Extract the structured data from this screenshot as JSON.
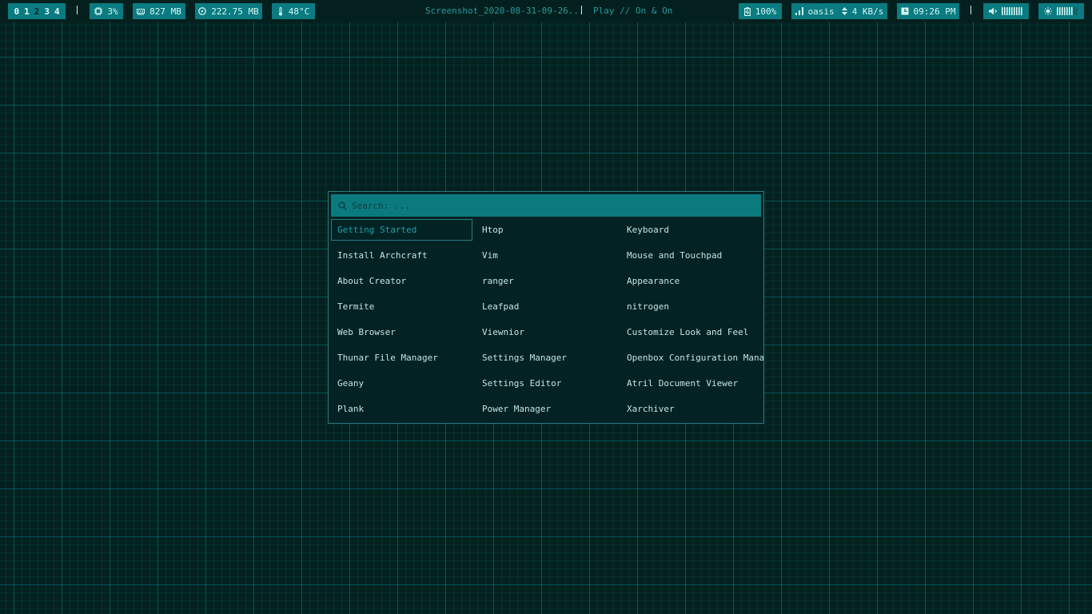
{
  "colors": {
    "background": "#03211f",
    "module_bg": "#0a7b80",
    "module_text": "#d6f6f4",
    "launcher_bg": "#032224",
    "launcher_border": "#2b7c80",
    "selected_text": "#1aa3a7"
  },
  "topbar": {
    "workspaces": [
      "0",
      "1",
      "2",
      "3",
      "4"
    ],
    "active_workspace": "2",
    "cpu": {
      "icon": "cpu-icon",
      "value": "3%"
    },
    "memory": {
      "icon": "memory-icon",
      "value": "827 MB"
    },
    "disk": {
      "icon": "disk-icon",
      "value": "222.75 MB"
    },
    "temperature": {
      "icon": "thermometer-icon",
      "value": "48°C"
    },
    "window_title": "Screenshot_2020-08-31-09-26...",
    "music": "Play // On & On",
    "battery": {
      "icon": "battery-icon",
      "value": "100%"
    },
    "network": {
      "icon": "wifi-signal-icon",
      "ssid": "oasis",
      "speed_icon": "up-down-arrows-icon",
      "speed": "4 KB/s"
    },
    "clock": {
      "icon": "clock-icon",
      "value": "09:26 PM"
    },
    "volume": {
      "icon": "speaker-icon",
      "level": 1.0
    },
    "brightness": {
      "icon": "brightness-icon",
      "level": 0.7
    }
  },
  "launcher": {
    "search_icon": "search-icon",
    "search_placeholder": "Search: ...",
    "selected_index": 0,
    "items": [
      "Getting Started",
      "Htop",
      "Keyboard",
      "Install Archcraft",
      "Vim",
      "Mouse and Touchpad",
      "About Creator",
      "ranger",
      "Appearance",
      "Termite",
      "Leafpad",
      "nitrogen",
      "Web Browser",
      "Viewnior",
      "Customize Look and Feel",
      "Thunar File Manager",
      "Settings Manager",
      "Openbox Configuration Mana…",
      "Geany",
      "Settings Editor",
      "Atril Document Viewer",
      "Plank",
      "Power Manager",
      "Xarchiver"
    ]
  }
}
